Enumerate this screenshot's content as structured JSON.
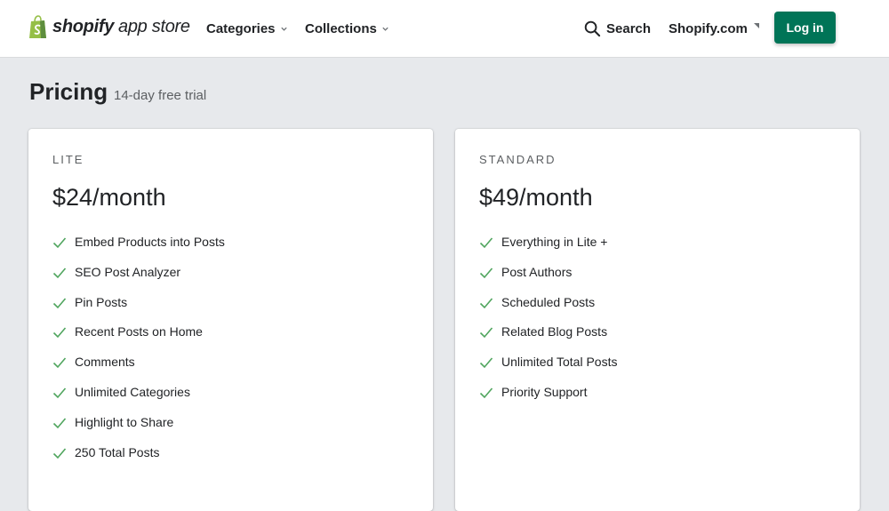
{
  "header": {
    "logo_word": "shopify",
    "logo_sub": "app store",
    "nav": [
      {
        "label": "Categories"
      },
      {
        "label": "Collections"
      }
    ],
    "search_label": "Search",
    "shopify_link": "Shopify.com",
    "login_label": "Log in",
    "colors": {
      "brand_green": "#95bf47",
      "login_bg": "#007457"
    }
  },
  "page": {
    "title": "Pricing",
    "subtitle": "14-day free trial"
  },
  "plans": [
    {
      "name": "LITE",
      "price": "$24/month",
      "features": [
        "Embed Products into Posts",
        "SEO Post Analyzer",
        "Pin Posts",
        "Recent Posts on Home",
        "Comments",
        "Unlimited Categories",
        "Highlight to Share",
        "250 Total Posts"
      ]
    },
    {
      "name": "STANDARD",
      "price": "$49/month",
      "features": [
        "Everything in Lite +",
        "Post Authors",
        "Scheduled Posts",
        "Related Blog Posts",
        "Unlimited Total Posts",
        "Priority Support"
      ]
    }
  ],
  "icons": {
    "logo": "shopping-bag-icon",
    "search": "search-icon",
    "dropdown": "chevron-down-icon",
    "external": "external-arrow-icon",
    "feature": "check-icon"
  },
  "check_color": "#50a55e"
}
